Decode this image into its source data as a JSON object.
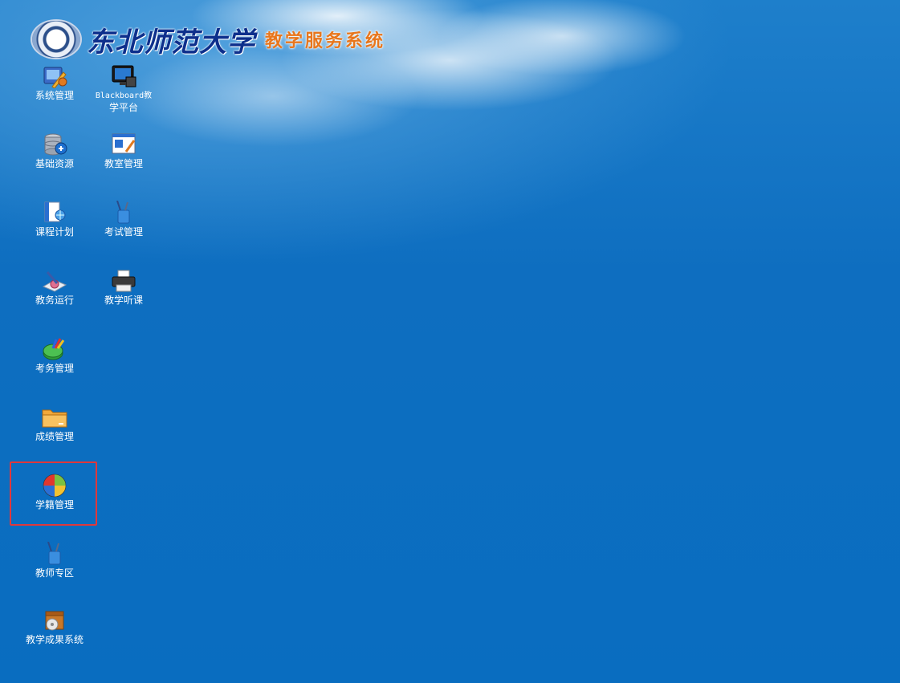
{
  "header": {
    "university_name": "东北师范大学",
    "system_name": "教学服务系统"
  },
  "icons": {
    "system_mgmt": "系统管理",
    "blackboard_line1": "Blackboard教",
    "blackboard_line2": "学平台",
    "basic_resources": "基础资源",
    "classroom_mgmt": "教室管理",
    "course_plan": "课程计划",
    "exam_mgmt": "考试管理",
    "teaching_ops": "教务运行",
    "class_observation": "教学听课",
    "exam_affairs": "考务管理",
    "grade_mgmt": "成绩管理",
    "student_status": "学籍管理",
    "teacher_zone": "教师专区",
    "teaching_achievements": "教学成果系统"
  },
  "selected_item": "学籍管理"
}
